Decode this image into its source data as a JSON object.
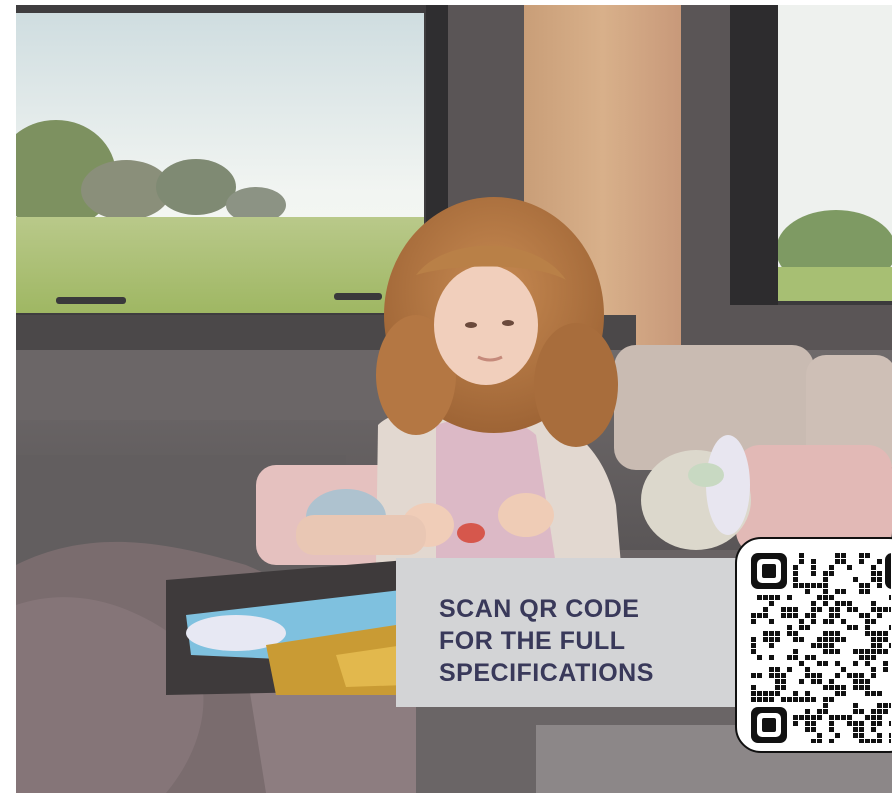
{
  "cta": {
    "lines": [
      "SCAN QR CODE",
      "FOR THE FULL",
      "SPECIFICATIONS"
    ]
  },
  "colors": {
    "cta_text": "#39395a",
    "cta_panel": "#d3d4d6",
    "qr_border": "#111111"
  }
}
